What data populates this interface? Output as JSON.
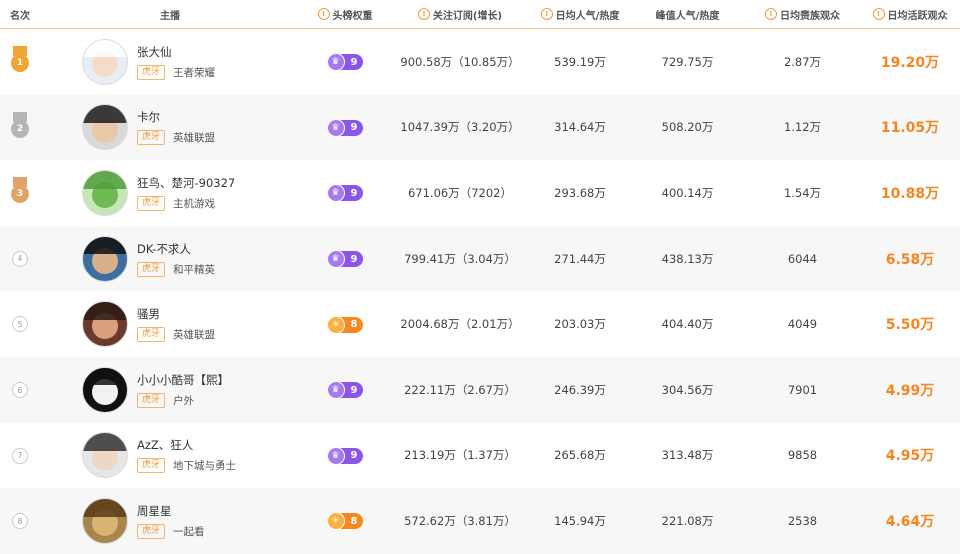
{
  "headers": {
    "rank": "名次",
    "anchor": "主播",
    "weight": "头榜权重",
    "follow": "关注订阅(增长)",
    "daily": "日均人气/热度",
    "peak": "峰值人气/热度",
    "gift": "日均赉族观众",
    "active": "日均活跃观众"
  },
  "colors": {
    "gold": "#f2a532",
    "silver": "#b5b5b5",
    "bronze": "#e0a566",
    "purple_badge": "#8a55e8",
    "orange_badge": "#f5891f",
    "active_value": "#f5861f"
  },
  "rows": [
    {
      "rank": "1",
      "medal": "gold",
      "name": "张大仙",
      "platform": "虎牙",
      "category": "王者荣耀",
      "weight": "9",
      "weight_type": "purple",
      "follow": "900.58万（10.85万）",
      "daily": "539.19万",
      "peak": "729.75万",
      "gift": "2.87万",
      "active": "19.20万",
      "avatar": "white"
    },
    {
      "rank": "2",
      "medal": "silver",
      "name": "卡尔",
      "platform": "虎牙",
      "category": "英雄联盟",
      "weight": "9",
      "weight_type": "purple",
      "follow": "1047.39万（3.20万）",
      "daily": "314.64万",
      "peak": "508.20万",
      "gift": "1.12万",
      "active": "11.05万",
      "avatar": "dark"
    },
    {
      "rank": "3",
      "medal": "bronze",
      "name": "狂鸟、楚河-90327",
      "platform": "虎牙",
      "category": "主机游戏",
      "weight": "9",
      "weight_type": "purple",
      "follow": "671.06万（7202）",
      "daily": "293.68万",
      "peak": "400.14万",
      "gift": "1.54万",
      "active": "10.88万",
      "avatar": "green"
    },
    {
      "rank": "4",
      "medal": "none",
      "name": "DK-不求人",
      "platform": "虎牙",
      "category": "和平精英",
      "weight": "9",
      "weight_type": "purple",
      "follow": "799.41万（3.04万）",
      "daily": "271.44万",
      "peak": "438.13万",
      "gift": "6044",
      "active": "6.58万",
      "avatar": "blue"
    },
    {
      "rank": "5",
      "medal": "none",
      "name": "骚男",
      "platform": "虎牙",
      "category": "英雄联盟",
      "weight": "8",
      "weight_type": "orange",
      "follow": "2004.68万（2.01万）",
      "daily": "203.03万",
      "peak": "404.40万",
      "gift": "4049",
      "active": "5.50万",
      "avatar": "red"
    },
    {
      "rank": "6",
      "medal": "none",
      "name": "小小小酷哥【熙】",
      "platform": "虎牙",
      "category": "户外",
      "weight": "9",
      "weight_type": "purple",
      "follow": "222.11万（2.67万）",
      "daily": "246.39万",
      "peak": "304.56万",
      "gift": "7901",
      "active": "4.99万",
      "avatar": "black"
    },
    {
      "rank": "7",
      "medal": "none",
      "name": "AzZ、狂人",
      "platform": "虎牙",
      "category": "地下城与勇士",
      "weight": "9",
      "weight_type": "purple",
      "follow": "213.19万（1.37万）",
      "daily": "265.68万",
      "peak": "313.48万",
      "gift": "9858",
      "active": "4.95万",
      "avatar": "gray"
    },
    {
      "rank": "8",
      "medal": "none",
      "name": "周星星",
      "platform": "虎牙",
      "category": "一起看",
      "weight": "8",
      "weight_type": "orange",
      "follow": "572.62万（3.81万）",
      "daily": "145.94万",
      "peak": "221.08万",
      "gift": "2538",
      "active": "4.64万",
      "avatar": "brown"
    }
  ]
}
